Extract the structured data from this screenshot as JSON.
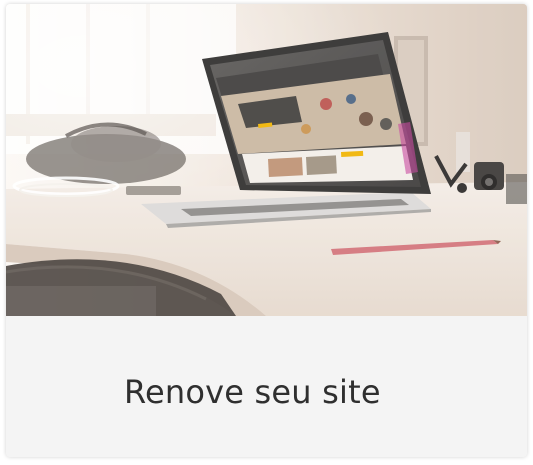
{
  "card": {
    "image_subject": "laptop-on-desk-photo",
    "title": "Renove seu site"
  }
}
